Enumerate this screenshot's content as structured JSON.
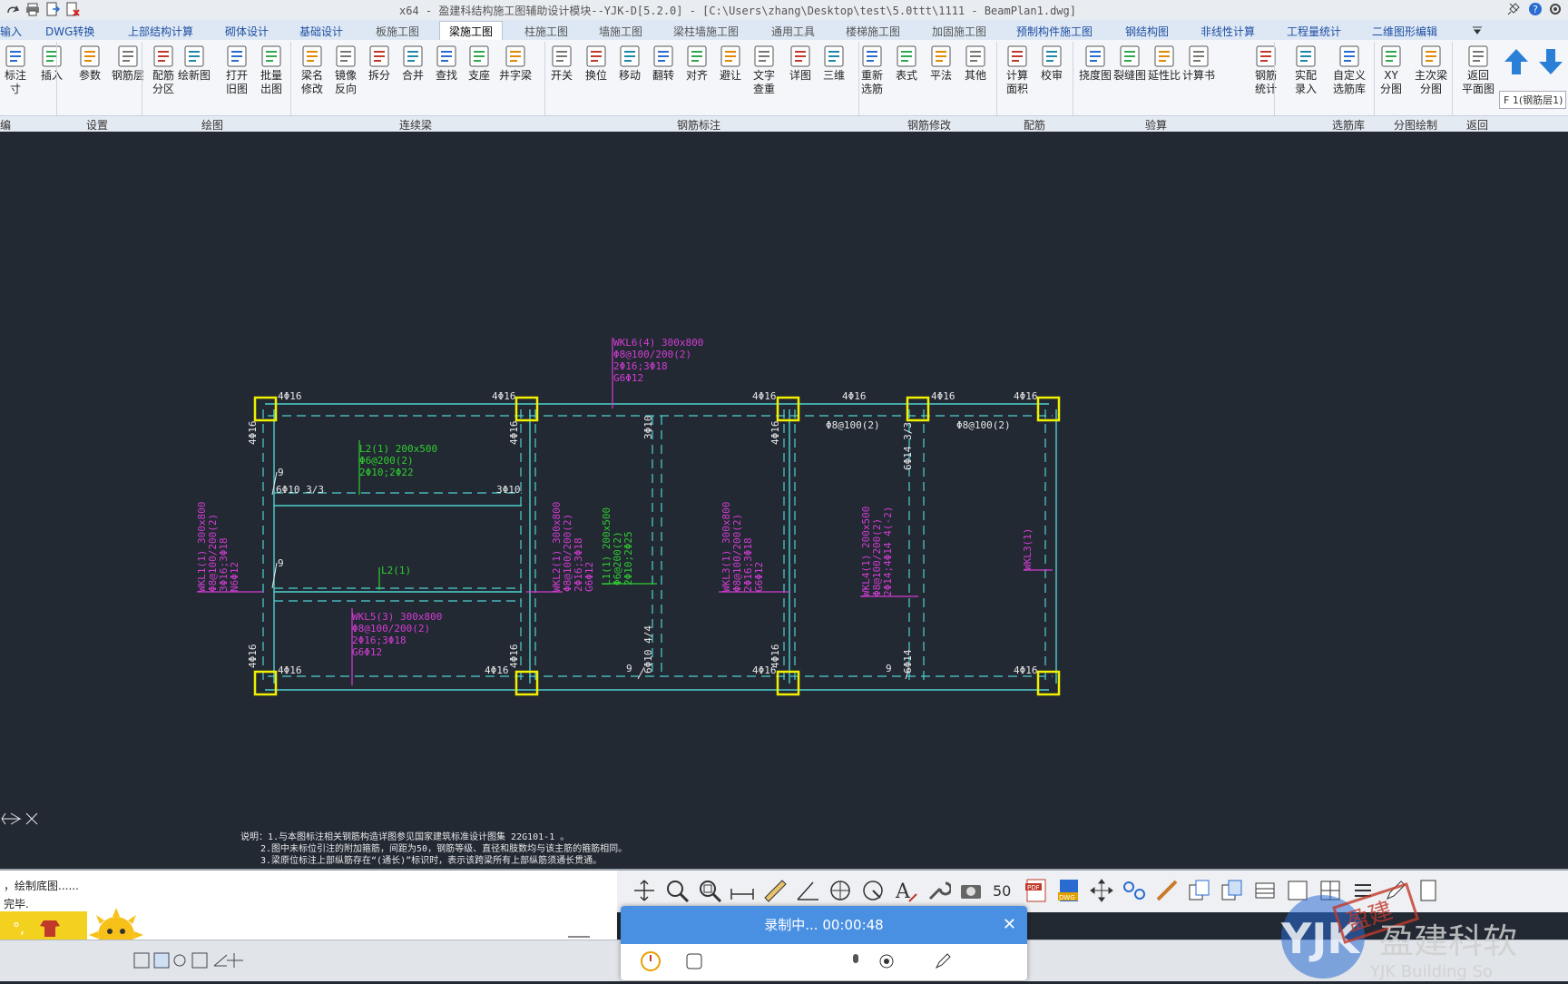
{
  "window": {
    "title": "x64 - 盈建科结构施工图辅助设计模块--YJK-D[5.2.0] - [C:\\Users\\zhang\\Desktop\\test\\5.0ttt\\1111 - BeamPlan1.dwg]"
  },
  "tabs": [
    "输入",
    "DWG转换",
    "上部结构计算",
    "砌体设计",
    "基础设计",
    "板施工图",
    "梁施工图",
    "柱施工图",
    "墙施工图",
    "梁柱墙施工图",
    "通用工具",
    "楼梯施工图",
    "加固施工图",
    "预制构件施工图",
    "钢结构图",
    "非线性计算",
    "工程量统计",
    "二维图形编辑"
  ],
  "ribbon": {
    "buttons": [
      {
        "name": "标注尺寸",
        "label": "标注\n寸"
      },
      {
        "name": "insert",
        "label": "插入"
      },
      {
        "name": "params",
        "label": "参数"
      },
      {
        "name": "rebar-layer",
        "label": "钢筋层"
      },
      {
        "name": "rebar-zone",
        "label": "配筋\n分区"
      },
      {
        "name": "draw-new",
        "label": "绘新图"
      },
      {
        "name": "open-old",
        "label": "打开\n旧图"
      },
      {
        "name": "batch-out",
        "label": "批量\n出图"
      },
      {
        "name": "beam-rename",
        "label": "梁名\n修改"
      },
      {
        "name": "mirror",
        "label": "镜像\n反向"
      },
      {
        "name": "split",
        "label": "拆分"
      },
      {
        "name": "merge",
        "label": "合并"
      },
      {
        "name": "find",
        "label": "查找"
      },
      {
        "name": "support",
        "label": "支座"
      },
      {
        "name": "cross-beam",
        "label": "井字梁"
      },
      {
        "name": "switch",
        "label": "开关"
      },
      {
        "name": "swap",
        "label": "换位"
      },
      {
        "name": "move",
        "label": "移动"
      },
      {
        "name": "flip",
        "label": "翻转"
      },
      {
        "name": "align",
        "label": "对齐"
      },
      {
        "name": "avoid",
        "label": "避让"
      },
      {
        "name": "text-overlap",
        "label": "文字\n查重"
      },
      {
        "name": "detail",
        "label": "详图"
      },
      {
        "name": "3d",
        "label": "三维"
      },
      {
        "name": "reselect",
        "label": "重新\n选筋"
      },
      {
        "name": "table",
        "label": "表式"
      },
      {
        "name": "flat",
        "label": "平法"
      },
      {
        "name": "other",
        "label": "其他"
      },
      {
        "name": "calc-area",
        "label": "计算\n面积"
      },
      {
        "name": "check",
        "label": "校审"
      },
      {
        "name": "deflection",
        "label": "挠度图"
      },
      {
        "name": "crack",
        "label": "裂缝图"
      },
      {
        "name": "ductility",
        "label": "延性比"
      },
      {
        "name": "calc-book",
        "label": "计算书"
      },
      {
        "name": "rebar-stat",
        "label": "钢筋\n统计"
      },
      {
        "name": "actual-input",
        "label": "实配\n录入"
      },
      {
        "name": "custom-lib",
        "label": "自定义\n选筋库"
      },
      {
        "name": "xy-split",
        "label": "XY\n分图"
      },
      {
        "name": "main-sub",
        "label": "主次梁\n分图"
      },
      {
        "name": "back-plan",
        "label": "返回\n平面图"
      }
    ],
    "groups": [
      "编",
      "设置",
      "绘图",
      "连续梁",
      "钢筋标注",
      "钢筋修改",
      "配筋",
      "验算",
      "选筋库",
      "分图绘制",
      "返回"
    ],
    "floor_select": "F 1(钢筋层1)"
  },
  "drawing": {
    "colors": {
      "axis": "#4fd1d0",
      "beam": "#4fd1d0",
      "column": "#f0f000",
      "label_magenta": "#d43cd4",
      "label_green": "#2fce2f",
      "text_white": "#e8e8e8"
    },
    "beam_labels": {
      "wkl6": [
        "WKL6(4) 300x800",
        "Φ8@100/200(2)",
        "2Φ16;3Φ18",
        "G6Φ12"
      ],
      "l2a": [
        "L2(1) 200x500",
        "Φ6@200(2)",
        "2Φ10;2Φ22"
      ],
      "l2b": [
        "L2(1)"
      ],
      "wkl1": [
        "WKL1(1) 300x800",
        "Φ8@100/200(2)",
        "3Φ16;3Φ18",
        "N6Φ12"
      ],
      "wkl5": [
        "WKL5(3) 300x800",
        "Φ8@100/200(2)",
        "2Φ16;3Φ18",
        "G6Φ12"
      ],
      "wkl2": [
        "WKL2(1) 300x800",
        "Φ8@100/200(2)",
        "2Φ16;3Φ18",
        "G6Φ12"
      ],
      "l1": [
        "L1(1) 200x500",
        "Φ6@200(2)",
        "2Φ10;2Φ25"
      ],
      "wkl3": [
        "WKL3(1) 300x800",
        "Φ8@100/200(2)",
        "2Φ16;3Φ18",
        "G6Φ12"
      ],
      "wkl4": [
        "WKL4(1) 200x500",
        "Φ8@100/200(2)",
        "2Φ14;4Φ14 4(-2)"
      ],
      "wkl3b": [
        "WKL3(1)"
      ]
    },
    "rebar_text": {
      "t1": "4Φ16",
      "t2": "4Φ16",
      "t3": "4Φ16",
      "t4": "4Φ16",
      "t5": "4Φ16",
      "t6": "4Φ16",
      "b1": "4Φ16",
      "b2": "4Φ16",
      "b3": "4Φ16",
      "b4": "4Φ16",
      "s1": "Φ8@100(2)",
      "s2": "Φ8@100(2)",
      "v1": "4Φ16",
      "v2": "4Φ16",
      "v3": "4Φ16",
      "v4": "3Φ10",
      "v5": "6Φ14 3/3",
      "vb1": "4Φ16",
      "vb2": "4Φ16",
      "vb3": "4Φ16",
      "vb4": "6Φ10 4/4",
      "vb5": "6Φ14",
      "h1": "6Φ10 3/3",
      "h2": "3Φ10",
      "n9a": "9",
      "n9b": "9",
      "n9c": "9",
      "n9d": "9"
    },
    "notes": [
      "说明：1.与本图标注相关钢筋构造详图参见国家建筑标准设计图集 22G101-1 。",
      "2.图中未标位引注的附加箍筋，间距为50，钢筋等级、直径和肢数均与该主筋的箍筋相同。",
      "3.梁原位标注上部纵筋存在“(通长)”标识时，表示该跨梁所有上部纵筋须通长贯通。"
    ]
  },
  "command_line": [
    "，绘制底图......",
    "完毕."
  ],
  "recorder": {
    "status": "录制中... 00:00:48"
  },
  "logo": {
    "cn": "盈建科软",
    "en": "YJK Building So"
  }
}
